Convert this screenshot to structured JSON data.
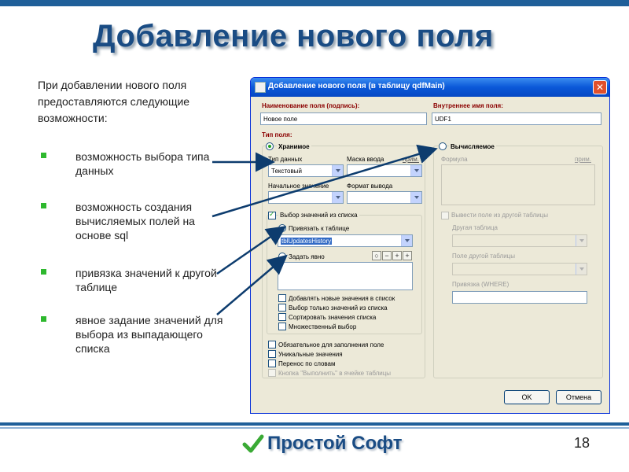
{
  "slide": {
    "title": "Добавление нового поля",
    "intro": "При добавлении нового поля предоставляются следующие возможности:",
    "bullets": [
      "возможность выбора типа данных",
      "возможность создания вычисляемых полей на основе sql",
      "привязка значений к другой таблице",
      "явное задание значений для выбора из выпадающего списка"
    ],
    "logo_text": "Простой Софт",
    "page_number": "18",
    "accent_color": "#1a4c84",
    "bullet_color": "#2eb82e"
  },
  "dialog": {
    "title": "Добавление нового поля (в таблицу qdfMain)",
    "field_name_label": "Наименование поля (подпись):",
    "field_name_value": "Новое поле",
    "internal_name_label": "Внутреннее имя поля:",
    "internal_name_value": "UDF1",
    "field_type_label": "Тип поля:",
    "stored_label": "Хранимое",
    "computed_label": "Вычисляемое",
    "data_type_label": "Тип данных",
    "data_type_value": "Текстовый",
    "input_mask_label": "Маска ввода",
    "input_mask_hint": "прим.",
    "default_value_label": "Начальное значение",
    "output_format_label": "Формат вывода",
    "formula_label": "Формула",
    "formula_hint": "прим.",
    "list_select_label": "Выбор значений из списка",
    "bind_table_label": "Привязать к таблице",
    "bind_table_value": "tblUpdatesHistory",
    "explicit_label": "Задать явно",
    "list_options": [
      "Добавлять новые значения в список",
      "Выбор только значений из списка",
      "Сортировать значения списка",
      "Множественный выбор"
    ],
    "output_other_table_label": "Вывести поле из другой таблицы",
    "other_table_label": "Другая таблица",
    "other_table_field_label": "Поле другой таблицы",
    "binding_where_label": "Привязка (WHERE)",
    "bottom_options": [
      "Обязательное для заполнения поле",
      "Уникальные значения",
      "Перенос по словам"
    ],
    "run_button_option": "Кнопка \"Выполнить\" в ячейке таблицы",
    "ok_label": "OK",
    "cancel_label": "Отмена",
    "close_glyph": "✕"
  }
}
